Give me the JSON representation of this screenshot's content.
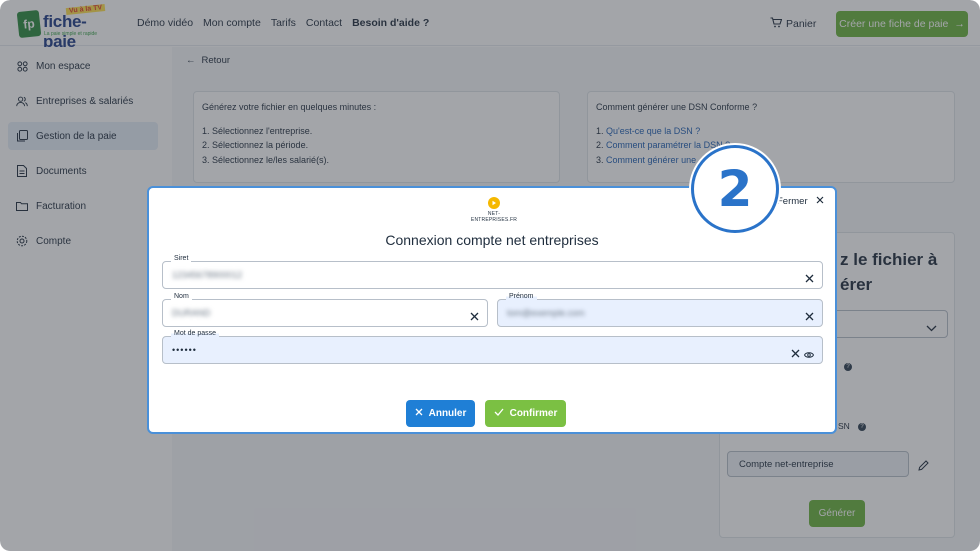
{
  "header": {
    "logo_name": "fiche-paie",
    "logo_badge": "Vu à la TV",
    "logo_tagline": "La paie simple et rapide",
    "nav": [
      "Démo vidéo",
      "Mon compte",
      "Tarifs",
      "Contact",
      "Besoin d'aide ?"
    ],
    "cart_label": "Panier",
    "cta_label": "Créer une fiche de paie"
  },
  "sidebar": {
    "items": [
      {
        "label": "Mon espace",
        "icon": "grid-icon"
      },
      {
        "label": "Entreprises & salariés",
        "icon": "users-icon"
      },
      {
        "label": "Gestion de la paie",
        "icon": "document-stack-icon"
      },
      {
        "label": "Documents",
        "icon": "document-icon"
      },
      {
        "label": "Facturation",
        "icon": "folder-icon"
      },
      {
        "label": "Compte",
        "icon": "gear-icon"
      }
    ],
    "active_index": 2
  },
  "main": {
    "back_label": "Retour",
    "left_box": {
      "title": "Générez votre fichier en quelques minutes :",
      "steps": [
        "1. Sélectionnez l'entreprise.",
        "2. Sélectionnez la période.",
        "3. Sélectionnez le/les salarié(s)."
      ]
    },
    "right_box": {
      "title": "Comment générer une DSN Conforme ?",
      "numbers": [
        "1.",
        "2.",
        "3."
      ],
      "links": [
        "Qu'est-ce que la DSN ?",
        "Comment paramétrer la DSN ?",
        "Comment générer une"
      ]
    },
    "panel": {
      "heading_line1": "z le fichier à",
      "heading_line2": "érer",
      "dsn_fragment": "SN",
      "account_value": "Compte net-entreprise",
      "generate_label": "Générer"
    }
  },
  "modal": {
    "logo_text": "NET-ENTREPRISES.FR",
    "close_label": "Fermer",
    "title": "Connexion compte net entreprises",
    "fields": {
      "siret": {
        "label": "Siret",
        "value": "12345678900012"
      },
      "nom": {
        "label": "Nom",
        "value": "DURAND"
      },
      "prenom": {
        "label": "Prénom",
        "value": "tom@exemple.com"
      },
      "password": {
        "label": "Mot de passe",
        "value": "••••••"
      }
    },
    "cancel_label": "Annuler",
    "confirm_label": "Confirmer"
  },
  "step_badge": "2",
  "colors": {
    "accent_green": "#6bb33c",
    "accent_blue": "#1f7fd6",
    "badge_blue": "#2a73c9",
    "link_blue": "#1f5fb3"
  }
}
